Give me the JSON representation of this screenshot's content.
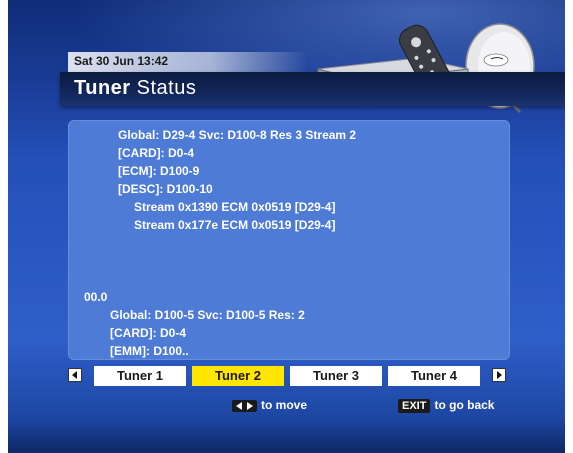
{
  "header": {
    "datetime": "Sat 30 Jun 13:42",
    "title_bold": "Tuner",
    "title_rest": " Status"
  },
  "status": {
    "lines": [
      "Global: D29-4 Svc: D100-8 Res 3 Stream 2",
      "[CARD]: D0-4",
      "[ECM]: D100-9",
      "[DESC]: D100-10",
      "Stream 0x1390 ECM 0x0519 [D29-4]",
      "Stream 0x177e ECM 0x0519 [D29-4]",
      "00.0",
      "Global: D100-5 Svc: D100-5 Res: 2",
      "[CARD]: D0-4",
      "[EMM]: D100.."
    ]
  },
  "tabs": [
    {
      "label": "Tuner 1"
    },
    {
      "label": "Tuner 2"
    },
    {
      "label": "Tuner 3"
    },
    {
      "label": "Tuner 4"
    }
  ],
  "active_tab": "Tuner 2",
  "hints": {
    "move": "to move",
    "exit_key": "EXIT",
    "back": "to go back"
  },
  "colors": {
    "background": "#2a59c4",
    "panel": "#4d7bd6",
    "active_tab": "#ffe600",
    "text": "#ffffff"
  },
  "icons": [
    "left-arrow-icon",
    "right-arrow-icon",
    "decoder-illustration",
    "remote-illustration",
    "satellite-dish-illustration"
  ]
}
